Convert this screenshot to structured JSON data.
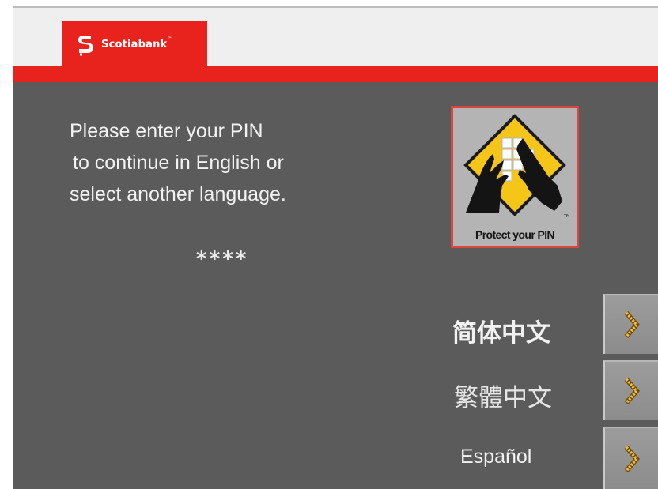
{
  "header": {
    "brand_name": "Scotiabank",
    "trademark": "™",
    "brand_color": "#e8231d",
    "brand_icon": "scotiabank-s-logo"
  },
  "main": {
    "prompt_lines": [
      "Please enter your PIN",
      "to continue in English or",
      "select another language."
    ],
    "pin_mask": "****",
    "background_color": "#5a5b5a"
  },
  "badge": {
    "caption": "Protect your PIN",
    "icon": "hand-shielding-keypad-icon"
  },
  "languages": [
    {
      "label": "简体中文",
      "arrow_icon": "chevron-right-icon"
    },
    {
      "label": "繁體中文",
      "arrow_icon": "chevron-right-icon"
    },
    {
      "label": "Español",
      "arrow_icon": "chevron-right-icon"
    }
  ]
}
